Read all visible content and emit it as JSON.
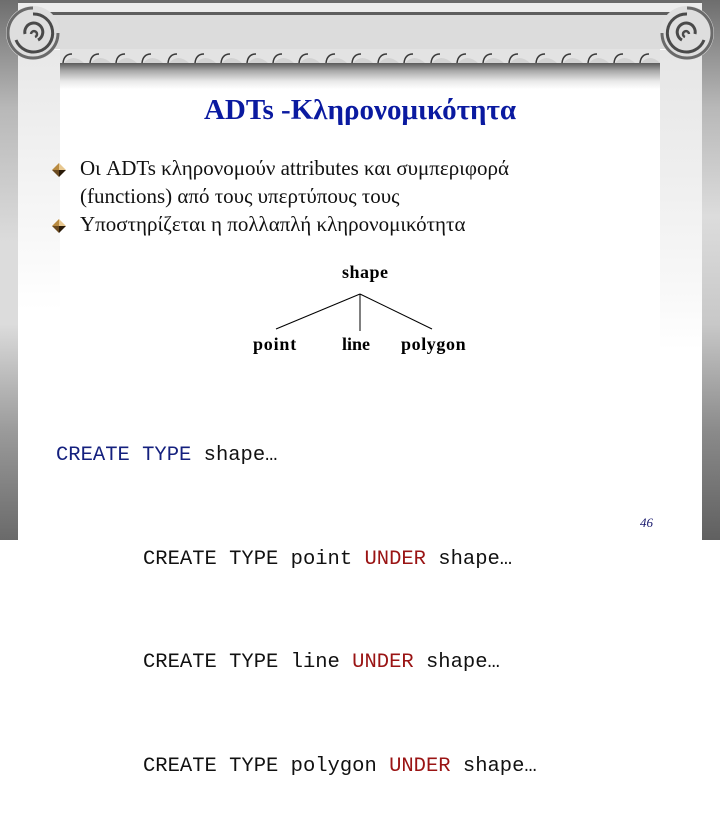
{
  "slide": {
    "title": "ADTs -Κληρονομικότητα",
    "bullets": [
      {
        "line1": "Οι ADTs κληρονομούν attributes και συμπεριφορά",
        "line2": "(functions) από τους υπερτύπους τους"
      },
      {
        "line1": "Υποστηρίζεται η πολλαπλή κληρονομικότητα",
        "line2": ""
      }
    ],
    "bullet_icon": "diamond-bullet-icon",
    "tree": {
      "root": "shape",
      "children": [
        "point",
        "line",
        "polygon"
      ]
    },
    "code": [
      {
        "indent": false,
        "kw1": "CREATE TYPE",
        "name": "shape…",
        "kw2": "",
        "parent": ""
      },
      {
        "indent": true,
        "kw1": "CREATE TYPE",
        "name": "point",
        "kw2": "UNDER",
        "parent": "shape…"
      },
      {
        "indent": true,
        "kw1": "CREATE TYPE",
        "name": "line",
        "kw2": "UNDER",
        "parent": "shape…"
      },
      {
        "indent": true,
        "kw1": "CREATE TYPE",
        "name": "polygon",
        "kw2": "UNDER",
        "parent": "shape…"
      }
    ],
    "page_number": "46",
    "colors": {
      "title": "#0a1aa0",
      "keyword_blue": "#14207e",
      "keyword_red": "#9a1414",
      "frame_gray": "#dcdcdc"
    }
  }
}
